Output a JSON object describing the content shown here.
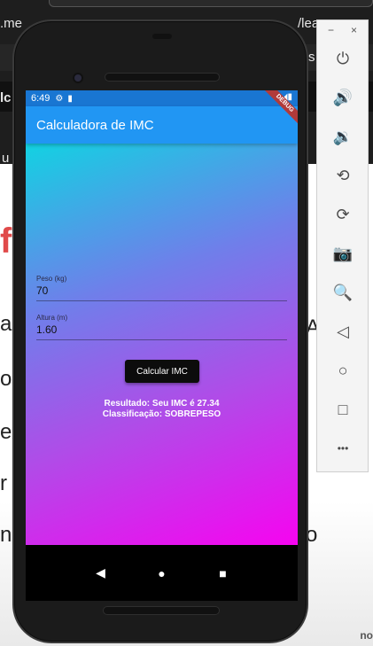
{
  "background": {
    "url_fragment": ".me",
    "url_right": "/lear",
    "tab_fragment": "s",
    "side_fragment": "lc",
    "side_fragment2": "u",
    "big_letter": "f",
    "lines": [
      "as",
      "o",
      "ex",
      "r",
      "n"
    ],
    "bottom_right": "no",
    "side_o": "o",
    "side_a": "A"
  },
  "phone": {
    "status_time": "6:49",
    "status_gear_icon": "⚙",
    "status_sd_icon": "▮",
    "status_right_icons": "▾◢▮",
    "debug_label": "DEBUG"
  },
  "app": {
    "title": "Calculadora de IMC",
    "weight_label": "Peso (kg)",
    "weight_value": "70",
    "height_label": "Altura (m)",
    "height_value": "1.60",
    "button_label": "Calcular IMC",
    "result_line1": "Resultado: Seu IMC é 27.34",
    "result_line2": "Classificação: SOBREPESO"
  },
  "nav": {
    "back_icon": "◀",
    "home_icon": "●",
    "recents_icon": "■"
  },
  "toolbar": {
    "minimize_icon": "−",
    "close_icon": "×",
    "power_icon": "⏻",
    "volume_up_icon": "🔊",
    "volume_down_icon": "🔉",
    "rotate_left_icon": "⟲",
    "rotate_right_icon": "⟳",
    "camera_icon": "📷",
    "zoom_icon": "🔍",
    "back_icon": "◁",
    "home_icon": "○",
    "overview_icon": "□",
    "more_icon": "•••"
  }
}
